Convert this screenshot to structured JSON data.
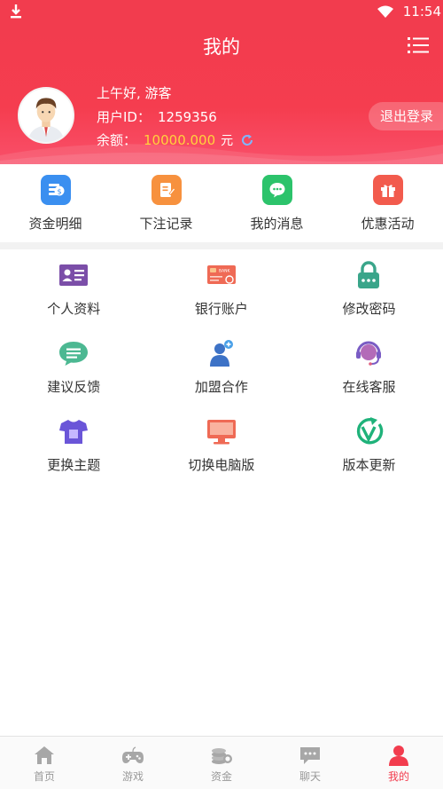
{
  "status_bar": {
    "time": "11:54"
  },
  "header": {
    "title": "我的",
    "greeting": "上午好, 游客",
    "user_id_label": "用户ID：",
    "user_id": "1259356",
    "balance_label": "余额：",
    "balance": "10000.000",
    "balance_unit": "元",
    "logout_label": "退出登录"
  },
  "quick_actions": [
    {
      "label": "资金明细",
      "icon": "money-detail-icon",
      "color": "#3a8ff0"
    },
    {
      "label": "下注记录",
      "icon": "bet-record-icon",
      "color": "#f7913e"
    },
    {
      "label": "我的消息",
      "icon": "message-icon",
      "color": "#2cc36b"
    },
    {
      "label": "优惠活动",
      "icon": "gift-icon",
      "color": "#f25b4d"
    }
  ],
  "menu_grid": [
    {
      "label": "个人资料",
      "icon": "profile-card-icon"
    },
    {
      "label": "银行账户",
      "icon": "bank-card-icon"
    },
    {
      "label": "修改密码",
      "icon": "lock-icon"
    },
    {
      "label": "建议反馈",
      "icon": "feedback-icon"
    },
    {
      "label": "加盟合作",
      "icon": "add-user-icon"
    },
    {
      "label": "在线客服",
      "icon": "headset-icon"
    },
    {
      "label": "更换主题",
      "icon": "tshirt-icon"
    },
    {
      "label": "切换电脑版",
      "icon": "monitor-icon"
    },
    {
      "label": "版本更新",
      "icon": "version-update-icon"
    }
  ],
  "bottom_nav": [
    {
      "label": "首页",
      "icon": "home-icon",
      "active": false
    },
    {
      "label": "游戏",
      "icon": "gamepad-icon",
      "active": false
    },
    {
      "label": "资金",
      "icon": "coins-icon",
      "active": false
    },
    {
      "label": "聊天",
      "icon": "chat-icon",
      "active": false
    },
    {
      "label": "我的",
      "icon": "user-icon",
      "active": true
    }
  ],
  "colors": {
    "brand": "#f23c4e",
    "balance": "#ffd23c"
  }
}
